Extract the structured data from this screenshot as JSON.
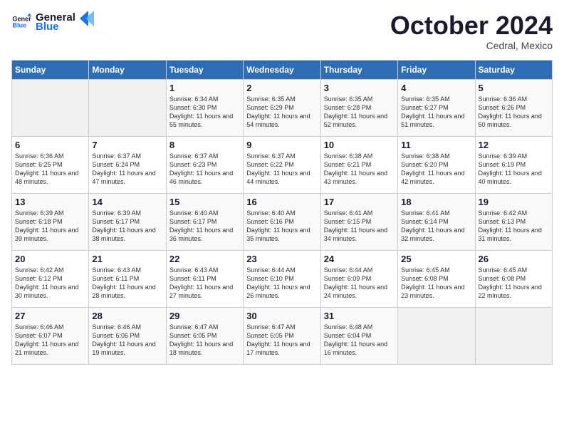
{
  "header": {
    "logo_general": "General",
    "logo_blue": "Blue",
    "month_title": "October 2024",
    "subtitle": "Cedral, Mexico"
  },
  "days_of_week": [
    "Sunday",
    "Monday",
    "Tuesday",
    "Wednesday",
    "Thursday",
    "Friday",
    "Saturday"
  ],
  "weeks": [
    [
      {
        "day": "",
        "info": ""
      },
      {
        "day": "",
        "info": ""
      },
      {
        "day": "1",
        "info": "Sunrise: 6:34 AM\nSunset: 6:30 PM\nDaylight: 11 hours and 55 minutes."
      },
      {
        "day": "2",
        "info": "Sunrise: 6:35 AM\nSunset: 6:29 PM\nDaylight: 11 hours and 54 minutes."
      },
      {
        "day": "3",
        "info": "Sunrise: 6:35 AM\nSunset: 6:28 PM\nDaylight: 11 hours and 52 minutes."
      },
      {
        "day": "4",
        "info": "Sunrise: 6:35 AM\nSunset: 6:27 PM\nDaylight: 11 hours and 51 minutes."
      },
      {
        "day": "5",
        "info": "Sunrise: 6:36 AM\nSunset: 6:26 PM\nDaylight: 11 hours and 50 minutes."
      }
    ],
    [
      {
        "day": "6",
        "info": "Sunrise: 6:36 AM\nSunset: 6:25 PM\nDaylight: 11 hours and 48 minutes."
      },
      {
        "day": "7",
        "info": "Sunrise: 6:37 AM\nSunset: 6:24 PM\nDaylight: 11 hours and 47 minutes."
      },
      {
        "day": "8",
        "info": "Sunrise: 6:37 AM\nSunset: 6:23 PM\nDaylight: 11 hours and 46 minutes."
      },
      {
        "day": "9",
        "info": "Sunrise: 6:37 AM\nSunset: 6:22 PM\nDaylight: 11 hours and 44 minutes."
      },
      {
        "day": "10",
        "info": "Sunrise: 6:38 AM\nSunset: 6:21 PM\nDaylight: 11 hours and 43 minutes."
      },
      {
        "day": "11",
        "info": "Sunrise: 6:38 AM\nSunset: 6:20 PM\nDaylight: 11 hours and 42 minutes."
      },
      {
        "day": "12",
        "info": "Sunrise: 6:39 AM\nSunset: 6:19 PM\nDaylight: 11 hours and 40 minutes."
      }
    ],
    [
      {
        "day": "13",
        "info": "Sunrise: 6:39 AM\nSunset: 6:18 PM\nDaylight: 11 hours and 39 minutes."
      },
      {
        "day": "14",
        "info": "Sunrise: 6:39 AM\nSunset: 6:17 PM\nDaylight: 11 hours and 38 minutes."
      },
      {
        "day": "15",
        "info": "Sunrise: 6:40 AM\nSunset: 6:17 PM\nDaylight: 11 hours and 36 minutes."
      },
      {
        "day": "16",
        "info": "Sunrise: 6:40 AM\nSunset: 6:16 PM\nDaylight: 11 hours and 35 minutes."
      },
      {
        "day": "17",
        "info": "Sunrise: 6:41 AM\nSunset: 6:15 PM\nDaylight: 11 hours and 34 minutes."
      },
      {
        "day": "18",
        "info": "Sunrise: 6:41 AM\nSunset: 6:14 PM\nDaylight: 11 hours and 32 minutes."
      },
      {
        "day": "19",
        "info": "Sunrise: 6:42 AM\nSunset: 6:13 PM\nDaylight: 11 hours and 31 minutes."
      }
    ],
    [
      {
        "day": "20",
        "info": "Sunrise: 6:42 AM\nSunset: 6:12 PM\nDaylight: 11 hours and 30 minutes."
      },
      {
        "day": "21",
        "info": "Sunrise: 6:43 AM\nSunset: 6:11 PM\nDaylight: 11 hours and 28 minutes."
      },
      {
        "day": "22",
        "info": "Sunrise: 6:43 AM\nSunset: 6:11 PM\nDaylight: 11 hours and 27 minutes."
      },
      {
        "day": "23",
        "info": "Sunrise: 6:44 AM\nSunset: 6:10 PM\nDaylight: 11 hours and 26 minutes."
      },
      {
        "day": "24",
        "info": "Sunrise: 6:44 AM\nSunset: 6:09 PM\nDaylight: 11 hours and 24 minutes."
      },
      {
        "day": "25",
        "info": "Sunrise: 6:45 AM\nSunset: 6:08 PM\nDaylight: 11 hours and 23 minutes."
      },
      {
        "day": "26",
        "info": "Sunrise: 6:45 AM\nSunset: 6:08 PM\nDaylight: 11 hours and 22 minutes."
      }
    ],
    [
      {
        "day": "27",
        "info": "Sunrise: 6:46 AM\nSunset: 6:07 PM\nDaylight: 11 hours and 21 minutes."
      },
      {
        "day": "28",
        "info": "Sunrise: 6:46 AM\nSunset: 6:06 PM\nDaylight: 11 hours and 19 minutes."
      },
      {
        "day": "29",
        "info": "Sunrise: 6:47 AM\nSunset: 6:05 PM\nDaylight: 11 hours and 18 minutes."
      },
      {
        "day": "30",
        "info": "Sunrise: 6:47 AM\nSunset: 6:05 PM\nDaylight: 11 hours and 17 minutes."
      },
      {
        "day": "31",
        "info": "Sunrise: 6:48 AM\nSunset: 6:04 PM\nDaylight: 11 hours and 16 minutes."
      },
      {
        "day": "",
        "info": ""
      },
      {
        "day": "",
        "info": ""
      }
    ]
  ]
}
